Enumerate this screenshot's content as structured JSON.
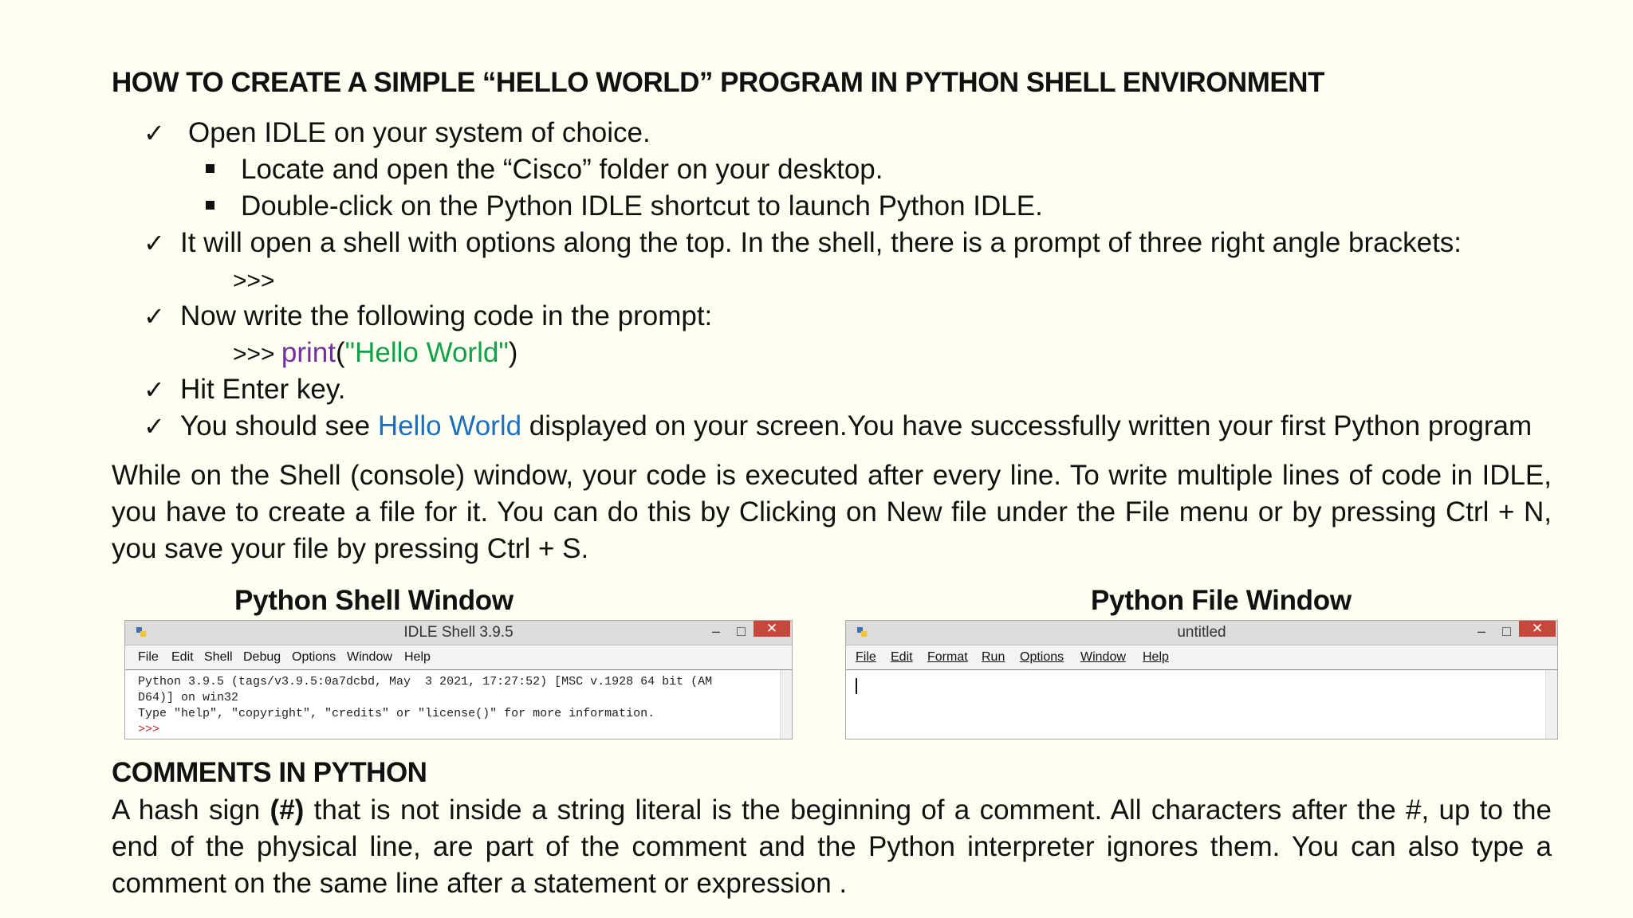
{
  "heading": "HOW TO CREATE A SIMPLE “HELLO WORLD” PROGRAM IN PYTHON SHELL ENVIRONMENT",
  "check_glyph": "✓",
  "steps": {
    "s1": "Open IDLE on your system of choice.",
    "s1a": "Locate and open the “Cisco” folder on your desktop.",
    "s1b": "Double-click on the Python IDLE shortcut to launch Python IDLE.",
    "s2": "It will open a shell with options along the top. In the shell, there is a prompt of three right angle brackets:",
    "s2_prompt": ">>>",
    "s3": "Now write the following code in the prompt:",
    "s3_code_prompt": ">>> ",
    "s3_code_func": "print",
    "s3_code_open": "(",
    "s3_code_str": "\"Hello World\"",
    "s3_code_close": ")",
    "s4": "Hit Enter key.",
    "s5_pre": "You should see ",
    "s5_hl": "Hello World",
    "s5_post": " displayed on your screen.You have successfully written your first Python program"
  },
  "paragraph1": "While on the Shell (console) window, your code is executed after every line. To write multiple lines of code in IDLE, you have to create a file for it. You can do this by Clicking on New file under the File menu or by pressing Ctrl + N, you save your file by pressing Ctrl + S.",
  "shell_window": {
    "caption": "Python Shell Window",
    "title": "IDLE Shell 3.9.5",
    "menu": [
      "File",
      "Edit",
      "Shell",
      "Debug",
      "Options",
      "Window",
      "Help"
    ],
    "lines": [
      "Python 3.9.5 (tags/v3.9.5:0a7dcbd, May  3 2021, 17:27:52) [MSC v.1928 64 bit (AM",
      "D64)] on win32",
      "Type \"help\", \"copyright\", \"credits\" or \"license()\" for more information."
    ],
    "prompt": ">>>"
  },
  "file_window": {
    "caption": "Python File Window",
    "title": "untitled",
    "menu": [
      "File",
      "Edit",
      "Format",
      "Run",
      "Options",
      "Window",
      "Help"
    ]
  },
  "window_controls": {
    "minimize": "–",
    "maximize": "□",
    "close": "✕"
  },
  "comments_heading": "COMMENTS IN PYTHON",
  "comments": {
    "pre": "A hash sign ",
    "bold": "(#)",
    "post": " that is not inside a string literal is the beginning of a comment. All characters after the #, up to the end of the physical line, are part of the comment and the Python interpreter ignores them. You can also type a comment on the same line after a statement or expression ."
  },
  "colors": {
    "background": "#fffff2",
    "purple": "#7030a0",
    "green": "#12a04a",
    "blue": "#1c6fc0",
    "close_red": "#c9463d"
  }
}
